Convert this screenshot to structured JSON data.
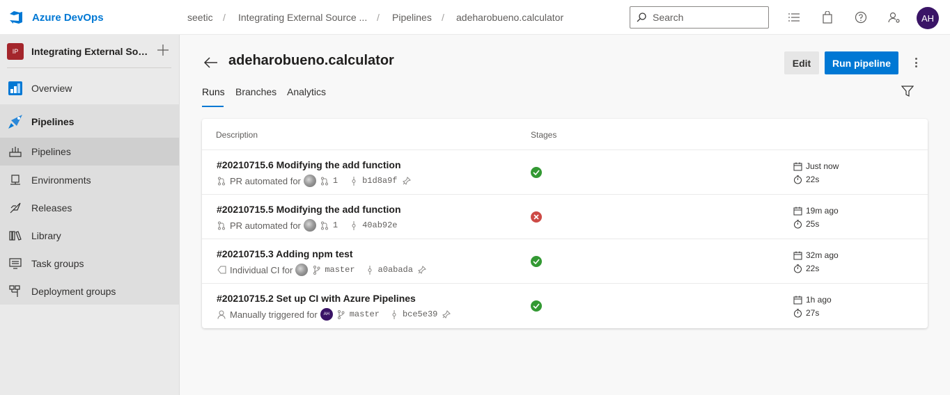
{
  "app": {
    "name": "Azure DevOps"
  },
  "breadcrumb": [
    "seetic",
    "Integrating External Source ...",
    "Pipelines",
    "adeharobueno.calculator"
  ],
  "search": {
    "placeholder": "Search"
  },
  "user": {
    "initials": "AH"
  },
  "sidebar": {
    "project": {
      "badge": "IP",
      "name": "Integrating External Source Code"
    },
    "items": [
      {
        "label": "Overview"
      },
      {
        "label": "Pipelines"
      },
      {
        "label": "Pipelines"
      },
      {
        "label": "Environments"
      },
      {
        "label": "Releases"
      },
      {
        "label": "Library"
      },
      {
        "label": "Task groups"
      },
      {
        "label": "Deployment groups"
      }
    ]
  },
  "page": {
    "title": "adeharobueno.calculator",
    "edit_label": "Edit",
    "run_label": "Run pipeline",
    "tabs": [
      {
        "label": "Runs"
      },
      {
        "label": "Branches"
      },
      {
        "label": "Analytics"
      }
    ]
  },
  "table": {
    "columns": [
      "Description",
      "Stages"
    ],
    "rows": [
      {
        "title": "#20210715.6 Modifying the add function",
        "trigger_text": "PR automated for",
        "ref": "1",
        "commit": "b1d8a9f",
        "status": "succeeded",
        "when": "Just now",
        "duration": "22s"
      },
      {
        "title": "#20210715.5 Modifying the add function",
        "trigger_text": "PR automated for",
        "ref": "1",
        "commit": "40ab92e",
        "status": "failed",
        "when": "19m ago",
        "duration": "25s"
      },
      {
        "title": "#20210715.3 Adding npm test",
        "trigger_text": "Individual CI for",
        "ref": "master",
        "commit": "a0abada",
        "status": "succeeded",
        "when": "32m ago",
        "duration": "22s"
      },
      {
        "title": "#20210715.2 Set up CI with Azure Pipelines",
        "trigger_text": "Manually triggered for",
        "avatar_initials": "AH",
        "ref": "master",
        "commit": "bce5e39",
        "status": "succeeded",
        "when": "1h ago",
        "duration": "27s"
      }
    ]
  },
  "colors": {
    "accent": "#0078d4",
    "success": "#339933",
    "failure": "#cd4a45",
    "avatar": "#3a1466",
    "project_badge": "#a4262c"
  }
}
